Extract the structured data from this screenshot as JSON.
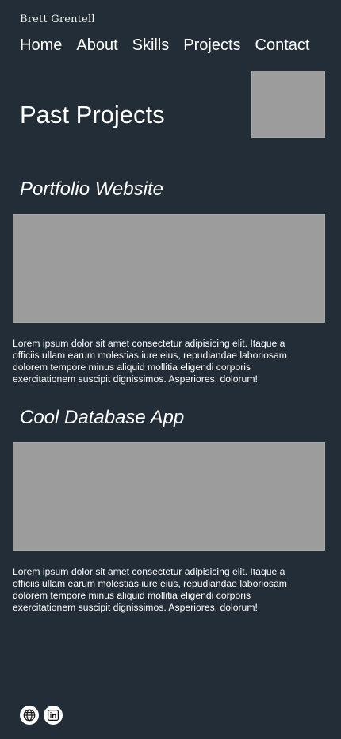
{
  "header": {
    "brand": "Brett Grentell",
    "nav": [
      "Home",
      "About",
      "Skills",
      "Projects",
      "Contact"
    ]
  },
  "page": {
    "title": "Past Projects"
  },
  "projects": [
    {
      "title": "Portfolio Website",
      "description": "Lorem ipsum dolor sit amet consectetur adipisicing elit. Itaque a officiis ullam earum molestias iure eius, repudiandae laboriosam dolorem tempore minus aliquid mollitia eligendi corporis exercitationem suscipit dignissimos. Asperiores, dolorum!"
    },
    {
      "title": "Cool Database App",
      "description": "Lorem ipsum dolor sit amet consectetur adipisicing elit. Itaque a officiis ullam earum molestias iure eius, repudiandae laboriosam dolorem tempore minus aliquid mollitia eligendi corporis exercitationem suscipit dignissimos. Asperiores, dolorum!"
    }
  ],
  "footer": {
    "social_icons": [
      "globe-icon",
      "linkedin-icon"
    ]
  },
  "colors": {
    "background": "#232d38",
    "text": "#ffffff",
    "placeholder_image": "#9c9c9c"
  }
}
